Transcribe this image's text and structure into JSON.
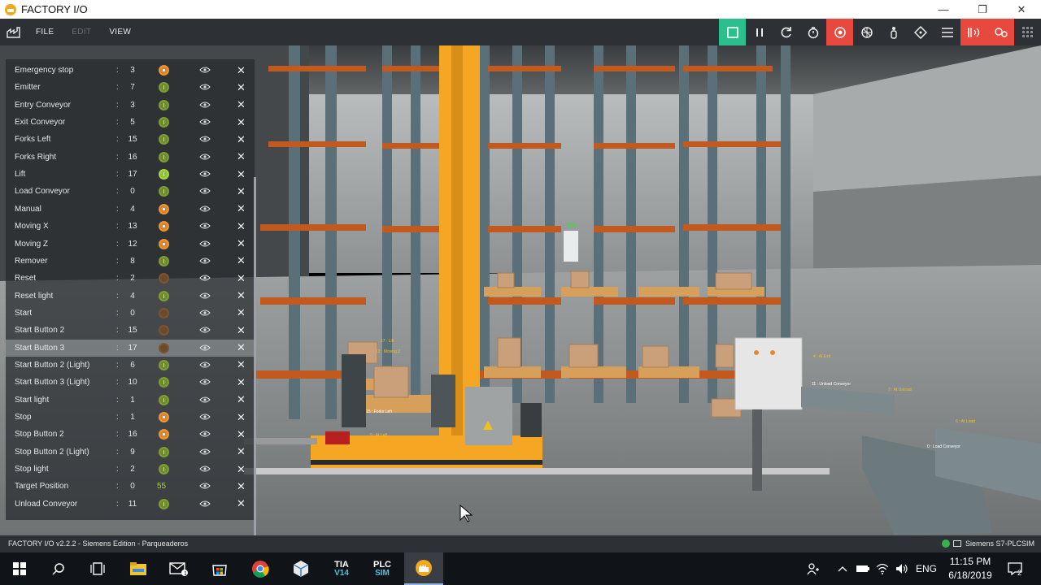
{
  "window": {
    "title": "FACTORY I/O",
    "controls": {
      "minimize": "—",
      "maximize": "❐",
      "close": "✕"
    }
  },
  "menu": {
    "file": "FILE",
    "edit": "EDIT",
    "view": "VIEW"
  },
  "toolbar_icons": [
    "play-icon",
    "pause-icon",
    "reset-icon",
    "timer-icon",
    "camera-target-icon",
    "fly-camera-icon",
    "first-person-icon",
    "drop-icon",
    "tag-list-icon",
    "drivers-icon",
    "sensors-icon",
    "grid-icon"
  ],
  "tags": [
    {
      "name": "Emergency stop",
      "address": "3",
      "indicator": "orange"
    },
    {
      "name": "Emitter",
      "address": "7",
      "indicator": "green"
    },
    {
      "name": "Entry Conveyor",
      "address": "3",
      "indicator": "green"
    },
    {
      "name": "Exit Conveyor",
      "address": "5",
      "indicator": "green"
    },
    {
      "name": "Forks Left",
      "address": "15",
      "indicator": "green"
    },
    {
      "name": "Forks Right",
      "address": "16",
      "indicator": "green"
    },
    {
      "name": "Lift",
      "address": "17",
      "indicator": "lime"
    },
    {
      "name": "Load Conveyor",
      "address": "0",
      "indicator": "green"
    },
    {
      "name": "Manual",
      "address": "4",
      "indicator": "orange"
    },
    {
      "name": "Moving X",
      "address": "13",
      "indicator": "orange"
    },
    {
      "name": "Moving Z",
      "address": "12",
      "indicator": "orange"
    },
    {
      "name": "Remover",
      "address": "8",
      "indicator": "green"
    },
    {
      "name": "Reset",
      "address": "2",
      "indicator": "brown"
    },
    {
      "name": "Reset light",
      "address": "4",
      "indicator": "green"
    },
    {
      "name": "Start",
      "address": "0",
      "indicator": "brown"
    },
    {
      "name": "Start Button 2",
      "address": "15",
      "indicator": "brown"
    },
    {
      "name": "Start Button 3",
      "address": "17",
      "indicator": "brown"
    },
    {
      "name": "Start Button 2 (Light)",
      "address": "6",
      "indicator": "green"
    },
    {
      "name": "Start Button 3 (Light)",
      "address": "10",
      "indicator": "green"
    },
    {
      "name": "Start light",
      "address": "1",
      "indicator": "green"
    },
    {
      "name": "Stop",
      "address": "1",
      "indicator": "orange"
    },
    {
      "name": "Stop Button 2",
      "address": "16",
      "indicator": "orange"
    },
    {
      "name": "Stop Button 2 (Light)",
      "address": "9",
      "indicator": "green"
    },
    {
      "name": "Stop light",
      "address": "2",
      "indicator": "green"
    },
    {
      "name": "Target Position",
      "address": "0",
      "value": "55"
    },
    {
      "name": "Unload Conveyor",
      "address": "11",
      "indicator": "green"
    }
  ],
  "selected_tag": "Start Button 3",
  "scene_labels": [
    "17 : Lift",
    "12 : Moving Z",
    "15 : Forks Left",
    "9 : At Left",
    "4 : At Exit",
    "11 : Unload Conveyor",
    "7 : At Unload",
    "0 : Load Conveyor",
    "6 : At Load"
  ],
  "status": {
    "left": "FACTORY I/O v2.2.2 - Siemens Edition - Parqueaderos",
    "driver": "Siemens S7-PLCSIM"
  },
  "taskbar": {
    "apps": [
      "windows-start-icon",
      "search-icon",
      "task-view-icon",
      "file-explorer-icon",
      "mail-icon",
      "store-icon",
      "chrome-icon",
      "box-icon",
      "tia-portal-icon",
      "plcsim-icon",
      "factory-io-icon"
    ],
    "tia_label": "TIA",
    "tia_version": "V14",
    "plcsim_label": "PLC",
    "plcsim_sub": "SIM",
    "mail_badge": "1",
    "language": "ENG",
    "time": "11:15 PM",
    "date": "6/18/2019",
    "notifications": "2"
  },
  "colors": {
    "toolbar_bg": "#2d3135",
    "play_green": "#2cbf8e",
    "accent_red": "#e8493f",
    "lift_orange": "#f5a623",
    "value_green": "#a7d13d"
  }
}
